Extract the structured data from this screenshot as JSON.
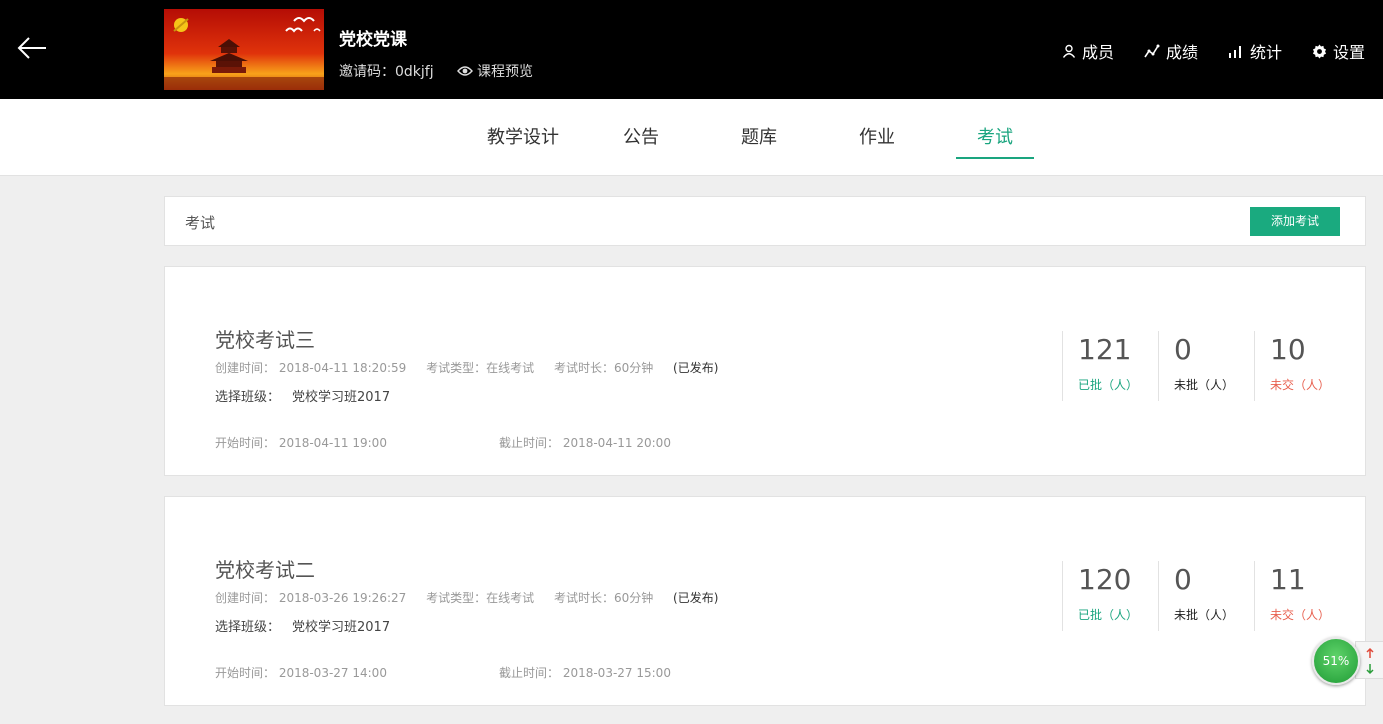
{
  "header": {
    "course_title": "党校党课",
    "invite_code": "邀请码：0dkjfj",
    "preview_label": "课程预览",
    "nav": [
      {
        "label": "成员",
        "icon": "user-icon"
      },
      {
        "label": "成绩",
        "icon": "trend-icon"
      },
      {
        "label": "统计",
        "icon": "bar-chart-icon"
      },
      {
        "label": "设置",
        "icon": "gear-icon"
      }
    ]
  },
  "tabs": [
    {
      "label": "教学设计"
    },
    {
      "label": "公告"
    },
    {
      "label": "题库"
    },
    {
      "label": "作业"
    },
    {
      "label": "考试",
      "active": true
    }
  ],
  "section": {
    "title": "考试",
    "add_button": "添加考试"
  },
  "exams": [
    {
      "name": "党校考试三",
      "created": "创建时间： 2018-04-11 18:20:59",
      "type": "考试类型：在线考试",
      "duration": "考试时长：60分钟",
      "status": "(已发布)",
      "class_label": "选择班级：",
      "class_name": "党校学习班2017",
      "start": "开始时间： 2018-04-11 19:00",
      "end": "截止时间： 2018-04-11 20:00",
      "graded": "121",
      "graded_label": "已批（人）",
      "ungraded": "0",
      "ungraded_label": "未批（人）",
      "unsubmitted": "10",
      "unsubmitted_label": "未交（人）"
    },
    {
      "name": "党校考试二",
      "created": "创建时间： 2018-03-26 19:26:27",
      "type": "考试类型：在线考试",
      "duration": "考试时长：60分钟",
      "status": "(已发布)",
      "class_label": "选择班级：",
      "class_name": "党校学习班2017",
      "start": "开始时间： 2018-03-27 14:00",
      "end": "截止时间： 2018-03-27 15:00",
      "graded": "120",
      "graded_label": "已批（人）",
      "ungraded": "0",
      "ungraded_label": "未批（人）",
      "unsubmitted": "11",
      "unsubmitted_label": "未交（人）"
    }
  ],
  "float_widget": {
    "percent": "51%"
  },
  "colors": {
    "accent": "#1aa57f",
    "unsubmitted": "#e8604f",
    "header_bg": "#000000"
  }
}
